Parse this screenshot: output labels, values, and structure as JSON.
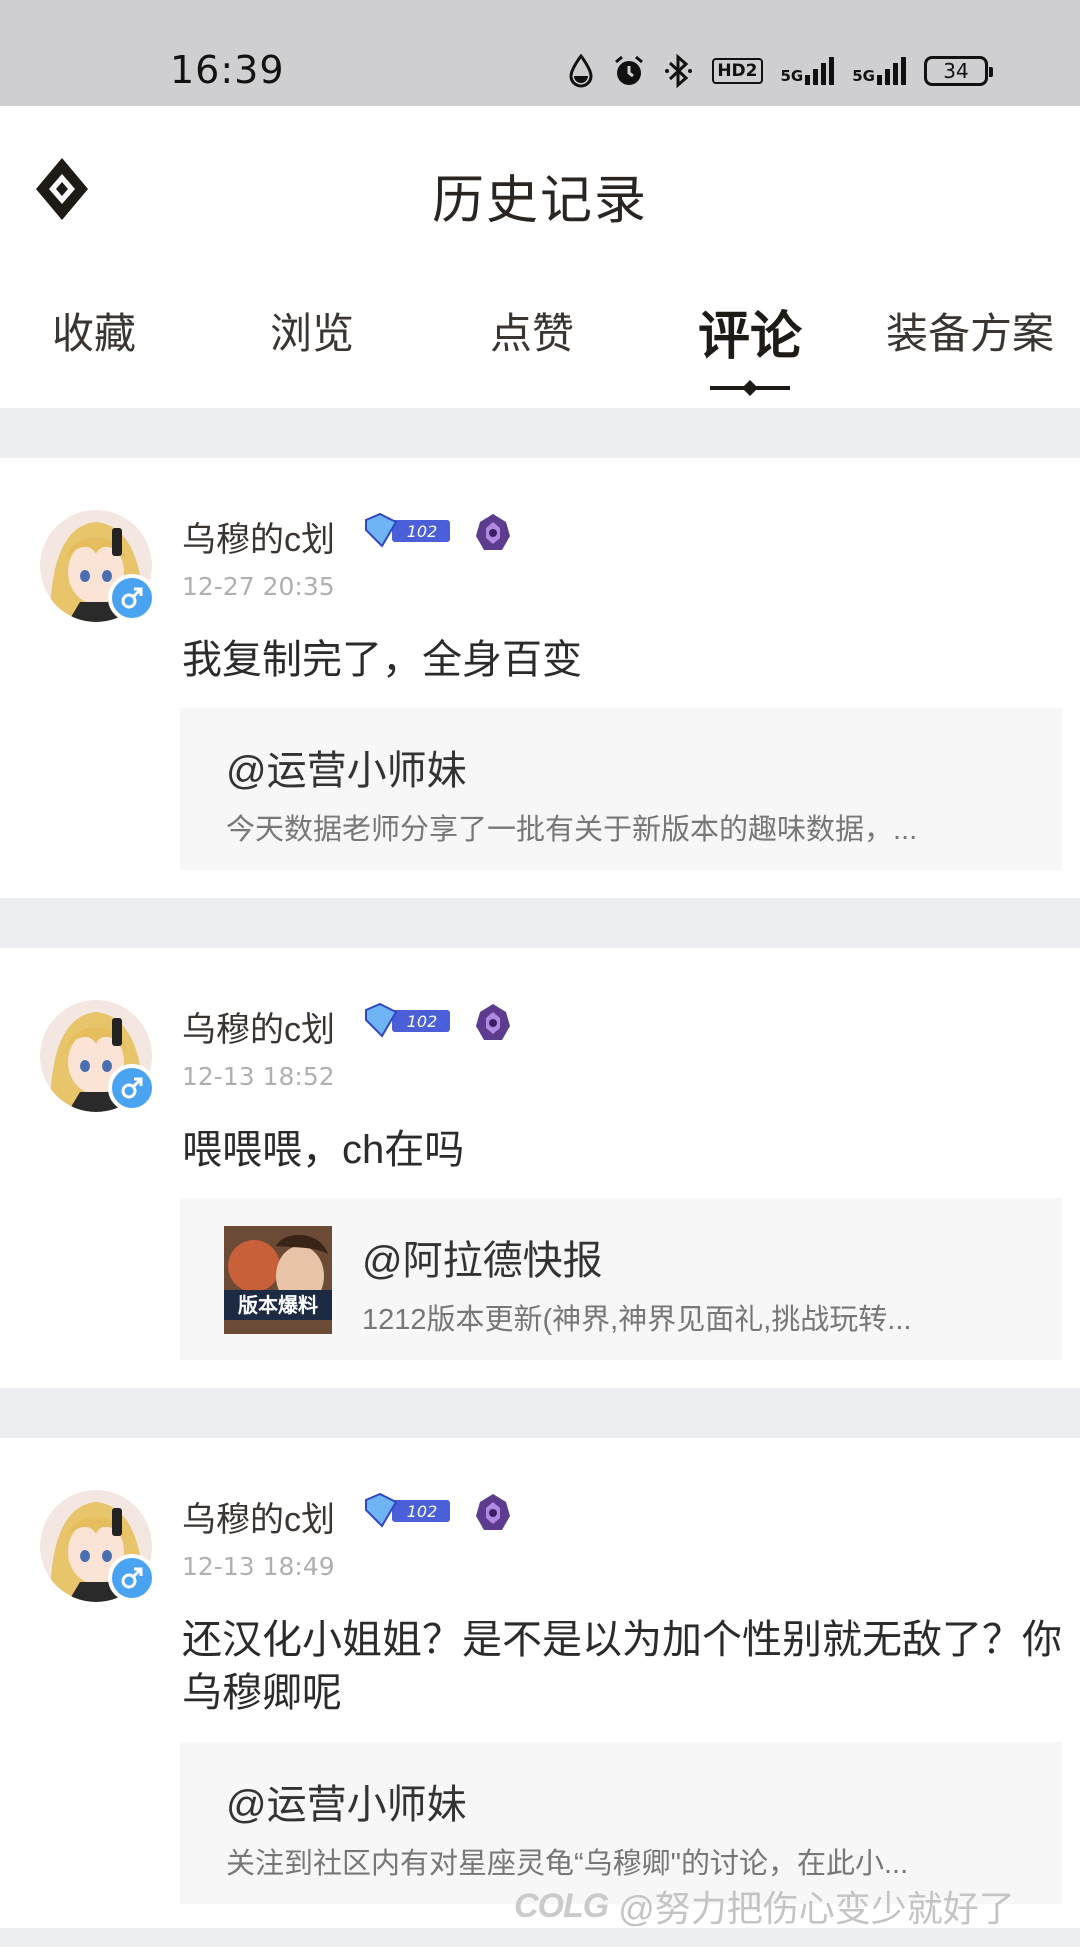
{
  "status_bar": {
    "time": "16:39",
    "icons": [
      "drop-icon",
      "alarm-icon",
      "bluetooth-icon",
      "hd-icon",
      "signal-5g-icon",
      "signal-5g-icon"
    ],
    "hd_label": "HD2",
    "signal1_label": "5G",
    "signal2_label": "5G",
    "battery": "34"
  },
  "header": {
    "title": "历史记录",
    "logo_icon": "diamond-logo-icon"
  },
  "tabs": [
    {
      "label": "收藏",
      "active": false
    },
    {
      "label": "浏览",
      "active": false
    },
    {
      "label": "点赞",
      "active": false
    },
    {
      "label": "评论",
      "active": true
    },
    {
      "label": "装备方案",
      "active": false
    }
  ],
  "comments": [
    {
      "username": "乌穆的c划",
      "level": "102",
      "time": "12-27 20:35",
      "text": "我复制完了，全身百变",
      "quote": {
        "author": "@运营小师妹",
        "excerpt": "今天数据老师分享了一批有关于新版本的趣味数据，...",
        "has_thumb": false
      }
    },
    {
      "username": "乌穆的c划",
      "level": "102",
      "time": "12-13 18:52",
      "text": "喂喂喂，ch在吗",
      "quote": {
        "author": "@阿拉德快报",
        "excerpt": "1212版本更新(神界,神界见面礼,挑战玩转...",
        "has_thumb": true,
        "thumb_text": "版本爆料"
      }
    },
    {
      "username": "乌穆的c划",
      "level": "102",
      "time": "12-13 18:49",
      "text": "还汉化小姐姐？是不是以为加个性别就无敌了？你乌穆卿呢",
      "quote": {
        "author": "@运营小师妹",
        "excerpt": "关注到社区内有对星座灵龟“乌穆卿\"的讨论，在此小...",
        "has_thumb": false
      }
    }
  ],
  "watermark": {
    "logo": "COLG",
    "text": "@努力把伤心变少就好了"
  },
  "colors": {
    "separator": "#eceef2",
    "quote_bg": "#f7f7f7",
    "gender_badge": "#4aa3f0",
    "level_badge": "#4a5fd8"
  }
}
